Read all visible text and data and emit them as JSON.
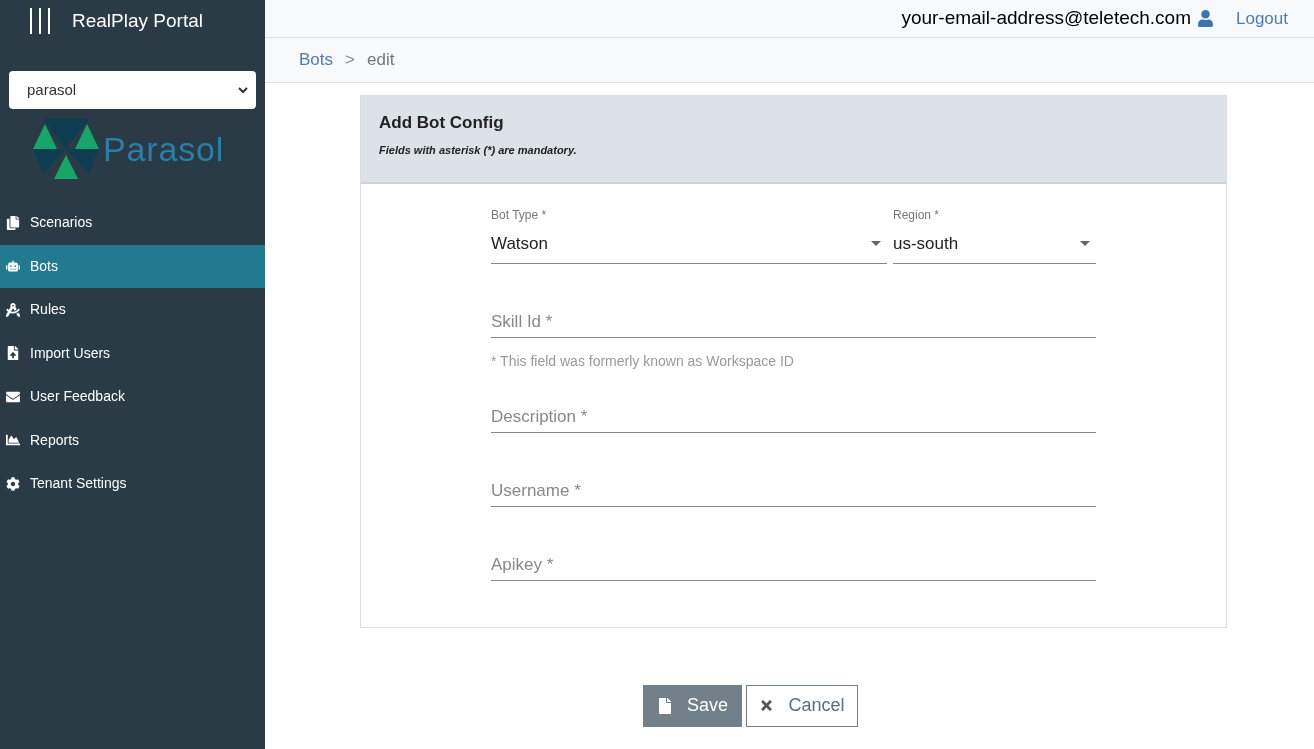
{
  "app": {
    "title": "RealPlay Portal"
  },
  "tenant_select": {
    "value": "parasol"
  },
  "logo": {
    "text": "Parasol"
  },
  "sidebar": {
    "items": [
      {
        "label": "Scenarios",
        "selected": false
      },
      {
        "label": "Bots",
        "selected": true
      },
      {
        "label": "Rules",
        "selected": false
      },
      {
        "label": "Import Users",
        "selected": false
      },
      {
        "label": "User Feedback",
        "selected": false
      },
      {
        "label": "Reports",
        "selected": false
      },
      {
        "label": "Tenant Settings",
        "selected": false
      }
    ]
  },
  "topbar": {
    "email": "your-email-address@teletech.com",
    "logout": "Logout"
  },
  "breadcrumb": {
    "items": [
      "Bots",
      "edit"
    ],
    "separator": ">"
  },
  "card": {
    "title": "Add Bot Config",
    "subtitle": "Fields with asterisk (*) are mandatory."
  },
  "fields": [
    {
      "kind": "selects",
      "items": [
        {
          "label": "Bot Type *",
          "value": "Watson"
        },
        {
          "label": "Region *",
          "value": "us-south"
        }
      ]
    },
    {
      "kind": "text",
      "placeholder": "Skill Id *",
      "hint": "* This field was formerly known as Workspace ID"
    },
    {
      "kind": "text",
      "placeholder": "Description *"
    },
    {
      "kind": "text",
      "placeholder": "Username *"
    },
    {
      "kind": "text",
      "placeholder": "Apikey *"
    }
  ],
  "buttons": {
    "save": "Save",
    "cancel": "Cancel"
  }
}
